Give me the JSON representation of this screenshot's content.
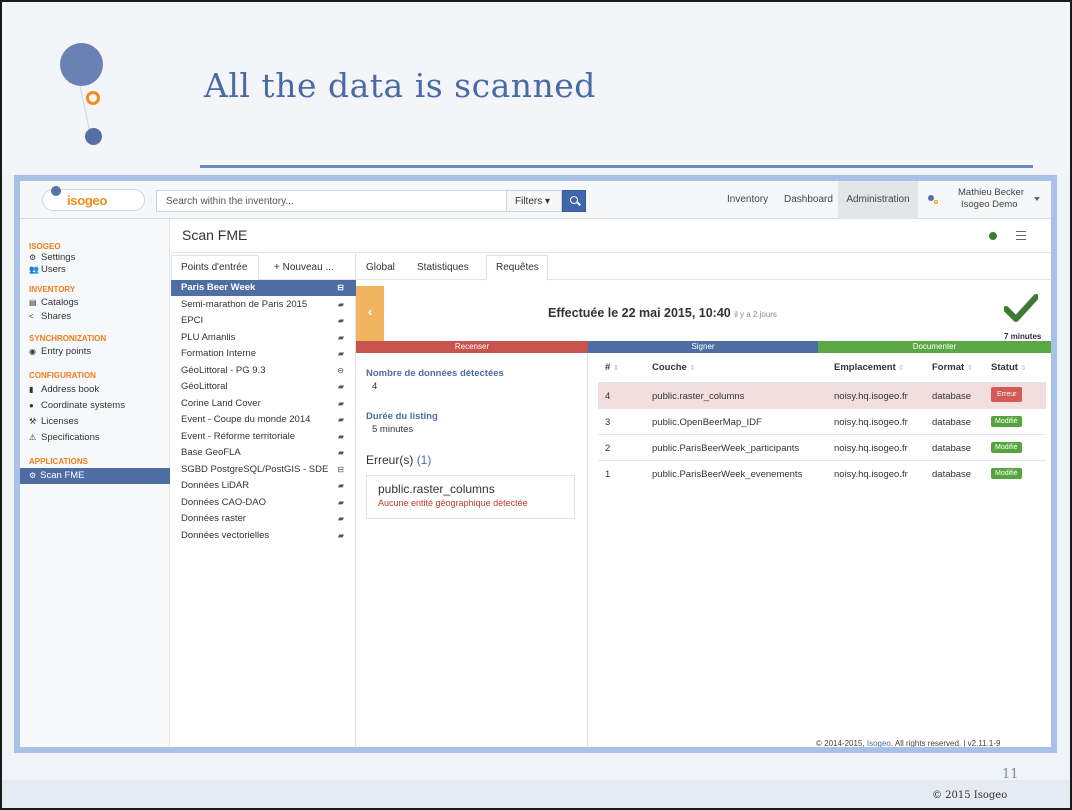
{
  "slide": {
    "title": "All the data is scanned",
    "page_number": "11",
    "copyright": "© 2015 Isogeo"
  },
  "navbar": {
    "brand": "isogeo",
    "search_placeholder": "Search within the inventory...",
    "filters_label": "Filters ▾",
    "links": [
      "Inventory",
      "Dashboard"
    ],
    "admin_label": "Administration",
    "user_name": "Mathieu Becker",
    "user_org": "Isogeo Demo"
  },
  "sidebar": {
    "sections": [
      {
        "title": "ISOGEO",
        "items": [
          {
            "icon": "⚙",
            "label": "Settings"
          },
          {
            "icon": "👥",
            "label": "Users"
          }
        ]
      },
      {
        "title": "INVENTORY",
        "items": [
          {
            "icon": "▤",
            "label": "Catalogs"
          },
          {
            "icon": "<",
            "label": "Shares"
          }
        ]
      },
      {
        "title": "SYNCHRONIZATION",
        "items": [
          {
            "icon": "◉",
            "label": "Entry points"
          }
        ]
      },
      {
        "title": "CONFIGURATION",
        "items": [
          {
            "icon": "▮",
            "label": "Address book"
          },
          {
            "icon": "●",
            "label": "Coordinate systems"
          },
          {
            "icon": "⚒",
            "label": "Licenses"
          },
          {
            "icon": "⚠",
            "label": "Specifications"
          }
        ]
      },
      {
        "title": "APPLICATIONS",
        "items": [
          {
            "icon": "⚙",
            "label": "Scan FME",
            "active": true
          }
        ]
      }
    ]
  },
  "main": {
    "page_title": "Scan FME",
    "entry_tabs": [
      "Points d'entrée",
      "+ Nouveau ..."
    ],
    "entries": [
      "Paris Beer Week",
      "Semi-marathon de Paris 2015",
      "EPCI",
      "PLU Amanlis",
      "Formation Interne",
      "GéoLittoral - PG 9.3",
      "GéoLittoral",
      "Corine Land Cover",
      "Event - Coupe du monde 2014",
      "Event - Réforme territoriale",
      "Base GeoFLA",
      "SGBD PostgreSQL/PostGIS - SDE",
      "Données LiDAR",
      "Données CAO-DAO",
      "Données raster",
      "Données vectorielles"
    ],
    "detail_tabs": [
      "Global",
      "Statistiques",
      "Requêtes"
    ],
    "run": {
      "label": "Effectuée le 22 mai 2015, 10:40",
      "relative": "il y a 2 jours",
      "duration": "7 minutes"
    },
    "phases": [
      {
        "label": "Recenser",
        "color": "#c9534f"
      },
      {
        "label": "Signer",
        "color": "#4d6da3"
      },
      {
        "label": "Documenter",
        "color": "#5aa845"
      }
    ],
    "info": {
      "count_label": "Nombre de données détectées",
      "count_value": "4",
      "duration_label": "Durée du listing",
      "duration_value": "5 minutes",
      "errors_label": "Erreur(s)",
      "errors_count": "(1)",
      "error_name": "public.raster_columns",
      "error_desc": "Aucune entité géographique détectée"
    },
    "table": {
      "headers": [
        "#",
        "Couche",
        "Emplacement",
        "Format",
        "Statut"
      ],
      "rows": [
        {
          "num": "4",
          "layer": "public.raster_columns",
          "location": "noisy.hq.isogeo.fr",
          "format": "database",
          "status": "Erreur"
        },
        {
          "num": "3",
          "layer": "public.OpenBeerMap_IDF",
          "location": "noisy.hq.isogeo.fr",
          "format": "database",
          "status": "Modifié"
        },
        {
          "num": "2",
          "layer": "public.ParisBeerWeek_participants",
          "location": "noisy.hq.isogeo.fr",
          "format": "database",
          "status": "Modifié"
        },
        {
          "num": "1",
          "layer": "public.ParisBeerWeek_evenements",
          "location": "noisy.hq.isogeo.fr",
          "format": "database",
          "status": "Modifié"
        }
      ]
    },
    "footer": {
      "prefix": "© 2014-2015,",
      "link": "Isogeo",
      "suffix": ". All rights reserved. | v2.11.1-9"
    }
  }
}
